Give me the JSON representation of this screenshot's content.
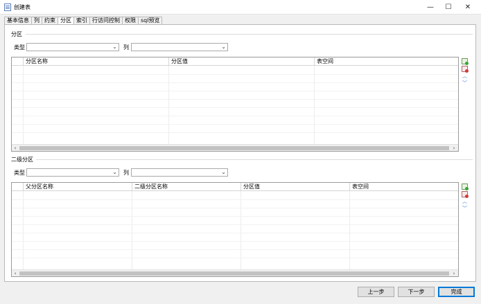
{
  "window": {
    "title": "创建表",
    "minimize_glyph": "—",
    "maximize_glyph": "☐",
    "close_glyph": "✕"
  },
  "tabs": [
    {
      "label": "基本信息"
    },
    {
      "label": "列"
    },
    {
      "label": "约束"
    },
    {
      "label": "分区",
      "active": true
    },
    {
      "label": "索引"
    },
    {
      "label": "行访问控制"
    },
    {
      "label": "权限"
    },
    {
      "label": "sql预览"
    }
  ],
  "partition": {
    "group_label": "分区",
    "type_label": "类型",
    "type_value": "",
    "column_label": "列",
    "column_value": "",
    "columns": [
      "分区名称",
      "分区值",
      "表空间"
    ]
  },
  "subpartition": {
    "group_label": "二级分区",
    "type_label": "类型",
    "type_value": "",
    "column_label": "列",
    "column_value": "",
    "columns": [
      "父分区名称",
      "二级分区名称",
      "分区值",
      "表空间"
    ]
  },
  "icons": {
    "add_row": "add-row-icon",
    "delete_row": "delete-row-icon",
    "move_up": "chevron-up-icon",
    "move_down": "chevron-down-icon",
    "up_glyph": "︿",
    "down_glyph": "﹀",
    "dropdown_glyph": "⌄",
    "scroll_left_glyph": "‹",
    "scroll_right_glyph": "›"
  },
  "footer": {
    "prev_label": "上一步",
    "next_label": "下一步",
    "finish_label": "完成"
  },
  "colors": {
    "accent": "#0078d7",
    "add_icon": "#3aa63a",
    "delete_icon": "#d23a3a"
  }
}
